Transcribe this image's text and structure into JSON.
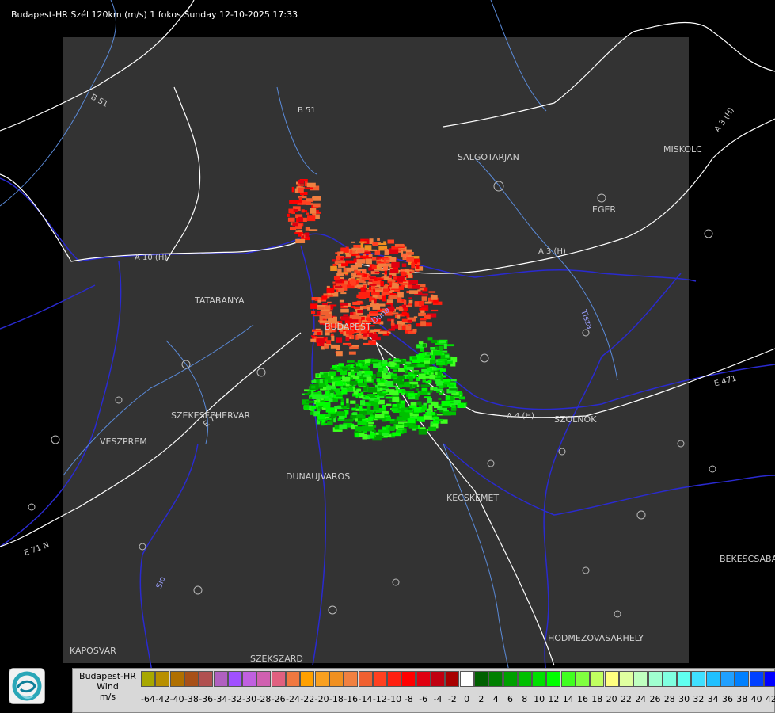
{
  "title": "Budapest-HR Szél 120km (m/s) 1 fokos Sunday 12-10-2025 17:33",
  "cities": [
    {
      "label": "SALGOTARJAN"
    },
    {
      "label": "MISKOLC"
    },
    {
      "label": "EGER"
    },
    {
      "label": "TATABANYA"
    },
    {
      "label": "BUDAPEST"
    },
    {
      "label": "SZEKESFEHERVAR"
    },
    {
      "label": "VESZPREM"
    },
    {
      "label": "DUNAUJVAROS"
    },
    {
      "label": "KECSKEMET"
    },
    {
      "label": "SZOLNOK"
    },
    {
      "label": "BEKESCSABA"
    },
    {
      "label": "HODMEZOVASARHELY"
    },
    {
      "label": "KAPOSVAR"
    },
    {
      "label": "SZEKSZARD"
    }
  ],
  "roads": [
    {
      "label": "B 51"
    },
    {
      "label": "B 51"
    },
    {
      "label": "A 3 (H)"
    },
    {
      "label": "A 3 (H)"
    },
    {
      "label": "A 10 (H)"
    },
    {
      "label": "A 4 (H)"
    },
    {
      "label": "E 471"
    },
    {
      "label": "E 71"
    },
    {
      "label": "E 71 N"
    }
  ],
  "rivers": [
    {
      "label": "Duna"
    },
    {
      "label": "Tisza"
    },
    {
      "label": "Sio"
    }
  ],
  "legend": {
    "station": "Budapest-HR",
    "quantity": "Wind",
    "unit": "m/s",
    "entries": [
      {
        "value": "-64",
        "color": "#a8a800"
      },
      {
        "value": "-42",
        "color": "#b89000"
      },
      {
        "value": "-40",
        "color": "#b07000"
      },
      {
        "value": "-38",
        "color": "#a85018"
      },
      {
        "value": "-36",
        "color": "#b05050"
      },
      {
        "value": "-34",
        "color": "#b060c0"
      },
      {
        "value": "-32",
        "color": "#a050ff"
      },
      {
        "value": "-30",
        "color": "#c060e0"
      },
      {
        "value": "-28",
        "color": "#d060b0"
      },
      {
        "value": "-26",
        "color": "#e06080"
      },
      {
        "value": "-24",
        "color": "#f07840"
      },
      {
        "value": "-22",
        "color": "#ffa000"
      },
      {
        "value": "-20",
        "color": "#f8a020"
      },
      {
        "value": "-18",
        "color": "#f09020"
      },
      {
        "value": "-16",
        "color": "#f08040"
      },
      {
        "value": "-14",
        "color": "#f06030"
      },
      {
        "value": "-12",
        "color": "#ff4020"
      },
      {
        "value": "-10",
        "color": "#ff2010"
      },
      {
        "value": "-8",
        "color": "#ff0000"
      },
      {
        "value": "-6",
        "color": "#e00010"
      },
      {
        "value": "-4",
        "color": "#c00010"
      },
      {
        "value": "-2",
        "color": "#a80000"
      },
      {
        "value": "0",
        "color": "#ffffff"
      },
      {
        "value": "2",
        "color": "#006000"
      },
      {
        "value": "4",
        "color": "#008000"
      },
      {
        "value": "6",
        "color": "#00a000"
      },
      {
        "value": "8",
        "color": "#00c000"
      },
      {
        "value": "10",
        "color": "#00e000"
      },
      {
        "value": "12",
        "color": "#00ff00"
      },
      {
        "value": "14",
        "color": "#40ff20"
      },
      {
        "value": "16",
        "color": "#80ff40"
      },
      {
        "value": "18",
        "color": "#c0ff60"
      },
      {
        "value": "20",
        "color": "#ffff80"
      },
      {
        "value": "22",
        "color": "#e0ffa0"
      },
      {
        "value": "24",
        "color": "#c0ffc0"
      },
      {
        "value": "26",
        "color": "#a0ffd0"
      },
      {
        "value": "28",
        "color": "#80ffe0"
      },
      {
        "value": "30",
        "color": "#60fff0"
      },
      {
        "value": "32",
        "color": "#40e0ff"
      },
      {
        "value": "34",
        "color": "#20c0ff"
      },
      {
        "value": "36",
        "color": "#20a0ff"
      },
      {
        "value": "38",
        "color": "#0080ff"
      },
      {
        "value": "40",
        "color": "#0040ff"
      },
      {
        "value": "42",
        "color": "#0000ff"
      }
    ]
  },
  "logo_icon": "radar-service-logo-icon"
}
